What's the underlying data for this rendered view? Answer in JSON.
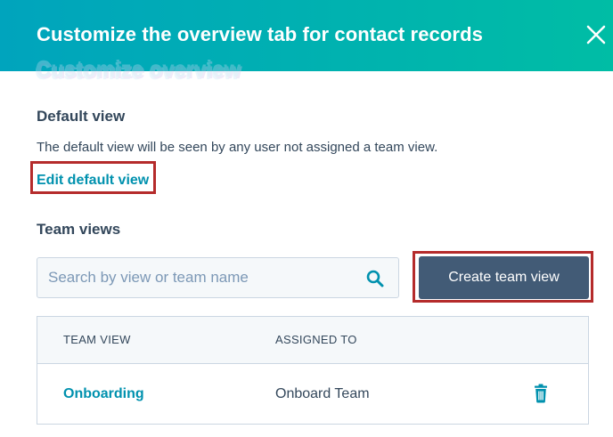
{
  "header": {
    "title": "Customize the overview tab for contact records",
    "close_icon": "close-icon"
  },
  "ghost_overlay": {
    "text": "Customize overview"
  },
  "default_view": {
    "heading": "Default view",
    "description": "The default view will be seen by any user not assigned a team view.",
    "edit_link": "Edit default view"
  },
  "team_views": {
    "heading": "Team views",
    "search": {
      "placeholder": "Search by view or team name",
      "value": "",
      "icon": "search-icon"
    },
    "create_button": "Create team view",
    "table": {
      "columns": [
        "TEAM VIEW",
        "ASSIGNED TO"
      ],
      "rows": [
        {
          "team_view": "Onboarding",
          "assigned_to": "Onboard Team",
          "action_icon": "trash-icon"
        }
      ]
    }
  },
  "colors": {
    "header_gradient_start": "#00a4bd",
    "header_gradient_end": "#00bda5",
    "link": "#0091ae",
    "primary_button": "#425b76",
    "highlight_outline": "#b52b2b",
    "text": "#33475b"
  }
}
